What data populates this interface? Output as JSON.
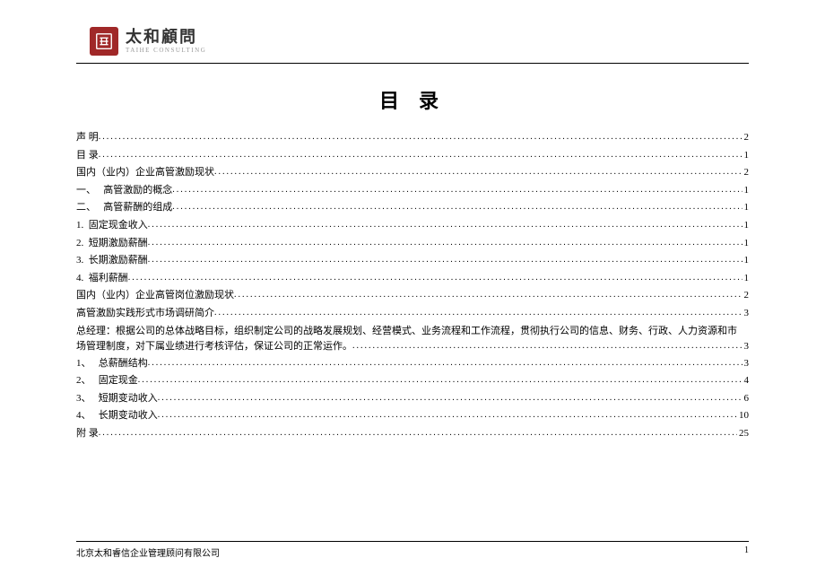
{
  "header": {
    "logo_title": "太和顧問",
    "logo_subtitle": "TAIHE CONSULTING"
  },
  "toc": {
    "title": "目 录",
    "entries": [
      {
        "label": "声 明",
        "page": "2",
        "indent": false
      },
      {
        "label": "目 录",
        "page": "1",
        "indent": false
      },
      {
        "label": "国内（业内）企业高管激励现状",
        "page": "2",
        "indent": false
      },
      {
        "label": "一、&nbsp;&nbsp;&nbsp;高管激励的概念",
        "page": "1",
        "indent": false
      },
      {
        "label": "二、&nbsp;&nbsp;&nbsp;高管薪酬的组成",
        "page": "1",
        "indent": false
      },
      {
        "label": "1.&nbsp;&nbsp;固定现金收入",
        "page": "1",
        "indent": false
      },
      {
        "label": "2.&nbsp;&nbsp;短期激励薪酬",
        "page": "1",
        "indent": false
      },
      {
        "label": "3.&nbsp;&nbsp;长期激励薪酬",
        "page": "1",
        "indent": false
      },
      {
        "label": "4.&nbsp;&nbsp;福利薪酬",
        "page": "1",
        "indent": false
      },
      {
        "label": "国内（业内）企业高管岗位激励现状",
        "page": "2",
        "indent": false
      },
      {
        "label": "高管激励实践形式市场调研简介",
        "page": "3",
        "indent": false
      },
      {
        "wrap_lead": "总经理：根据公司的总体战略目标，组织制定公司的战略发展规划、经营模式、业务流程和工作流程，贯彻执行公司的信息、财务、行政、人力资源和市",
        "wrap_tail": "场管理制度，对下属业绩进行考核评估，保证公司的正常运作。",
        "page": "3",
        "indent": false
      },
      {
        "label": "1、&nbsp;&nbsp;&nbsp;总薪酬结构",
        "page": "3",
        "indent": false
      },
      {
        "label": "2、&nbsp;&nbsp;&nbsp;固定现金",
        "page": "4",
        "indent": false
      },
      {
        "label": "3、&nbsp;&nbsp;&nbsp;短期变动收入",
        "page": "6",
        "indent": false
      },
      {
        "label": "4、&nbsp;&nbsp;&nbsp;长期变动收入",
        "page": "10",
        "indent": false
      },
      {
        "label": "附 录",
        "page": "25",
        "indent": false
      }
    ]
  },
  "footer": {
    "company": "北京太和睿信企业管理顾问有限公司",
    "page_number": "1"
  }
}
